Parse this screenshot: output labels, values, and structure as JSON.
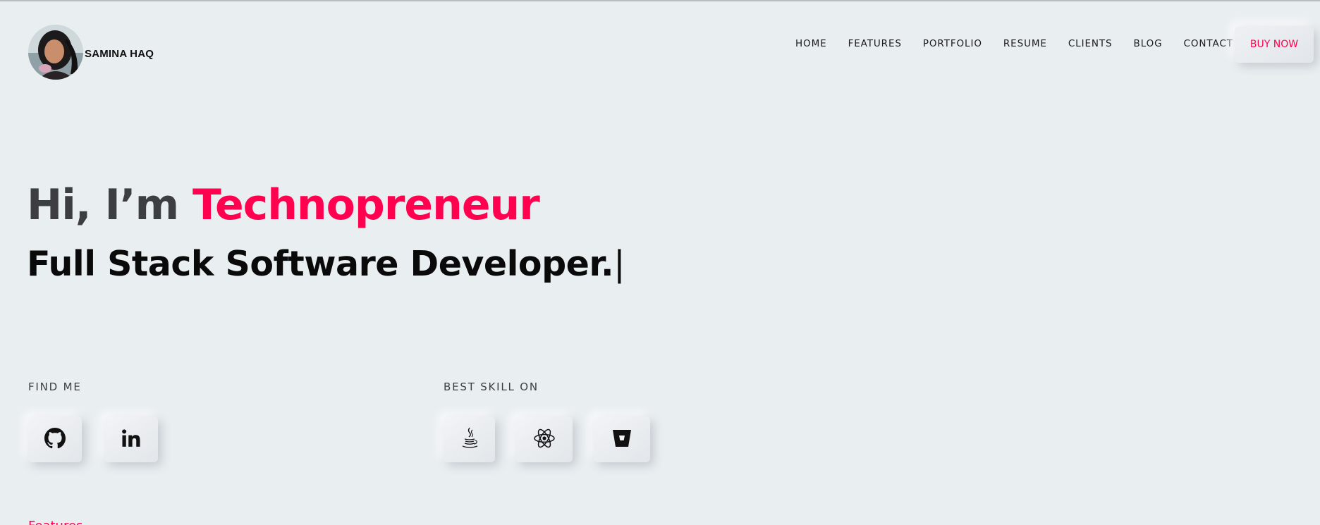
{
  "brand": {
    "name": "SAMINA HAQ"
  },
  "nav": {
    "items": [
      {
        "label": "HOME"
      },
      {
        "label": "FEATURES"
      },
      {
        "label": "PORTFOLIO"
      },
      {
        "label": "RESUME"
      },
      {
        "label": "CLIENTS"
      },
      {
        "label": "BLOG"
      },
      {
        "label": "CONTACT"
      }
    ],
    "cta_label": "BUY NOW"
  },
  "hero": {
    "greeting_prefix": "Hi, I’m ",
    "greeting_highlight": "Technopreneur",
    "subtitle": "Full Stack Software Developer.",
    "typing_cursor": "|"
  },
  "find_me": {
    "label": "FIND ME",
    "links": [
      {
        "icon": "github-icon"
      },
      {
        "icon": "linkedin-icon"
      }
    ]
  },
  "skills": {
    "label": "BEST SKILL ON",
    "items": [
      {
        "icon": "java-icon"
      },
      {
        "icon": "react-icon"
      },
      {
        "icon": "bitbucket-icon"
      }
    ]
  },
  "next_section": {
    "label": "Features"
  },
  "colors": {
    "accent": "#ff014f",
    "background": "#e9eef1",
    "text": "#3c3e41"
  }
}
